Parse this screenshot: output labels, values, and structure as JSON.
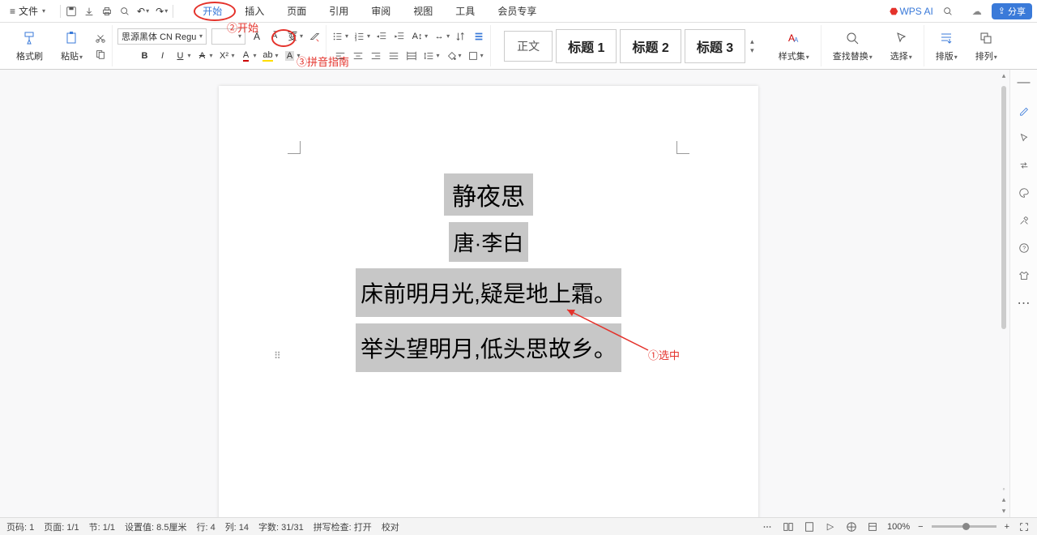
{
  "menubar": {
    "file": "文件",
    "tabs": [
      "开始",
      "插入",
      "页面",
      "引用",
      "审阅",
      "视图",
      "工具",
      "会员专享"
    ],
    "active_tab_index": 0,
    "wpsai": "WPS AI",
    "share": "分享"
  },
  "annotations": {
    "a1": "①选中",
    "a2": "②开始",
    "a3": "③拼音指南"
  },
  "ribbon": {
    "format_painter": "格式刷",
    "paste": "粘贴",
    "font_name": "思源黑体 CN Regu",
    "font_size": "",
    "style_body": "正文",
    "style_h1": "标题 1",
    "style_h2": "标题 2",
    "style_h3": "标题 3",
    "styles_lbl": "样式集",
    "find_lbl": "查找替换",
    "select_lbl": "选择",
    "layout_lbl": "排版",
    "arrange_lbl": "排列"
  },
  "document": {
    "title_line": "静夜思",
    "author_line": "唐·李白",
    "body1": "床前明月光,疑是地上霜。",
    "body2": "举头望明月,低头思故乡。"
  },
  "status": {
    "page_no": "页码: 1",
    "page": "页面: 1/1",
    "section": "节: 1/1",
    "setting": "设置值: 8.5厘米",
    "row": "行: 4",
    "col": "列: 14",
    "words": "字数: 31/31",
    "spell": "拼写检查: 打开",
    "proof": "校对",
    "zoom": "100%"
  },
  "icons": {
    "hamburger": "≡",
    "save": "save",
    "print": "print",
    "preview": "preview",
    "undo": "↶",
    "redo": "↷",
    "cloud": "☁",
    "search": "🔍"
  }
}
